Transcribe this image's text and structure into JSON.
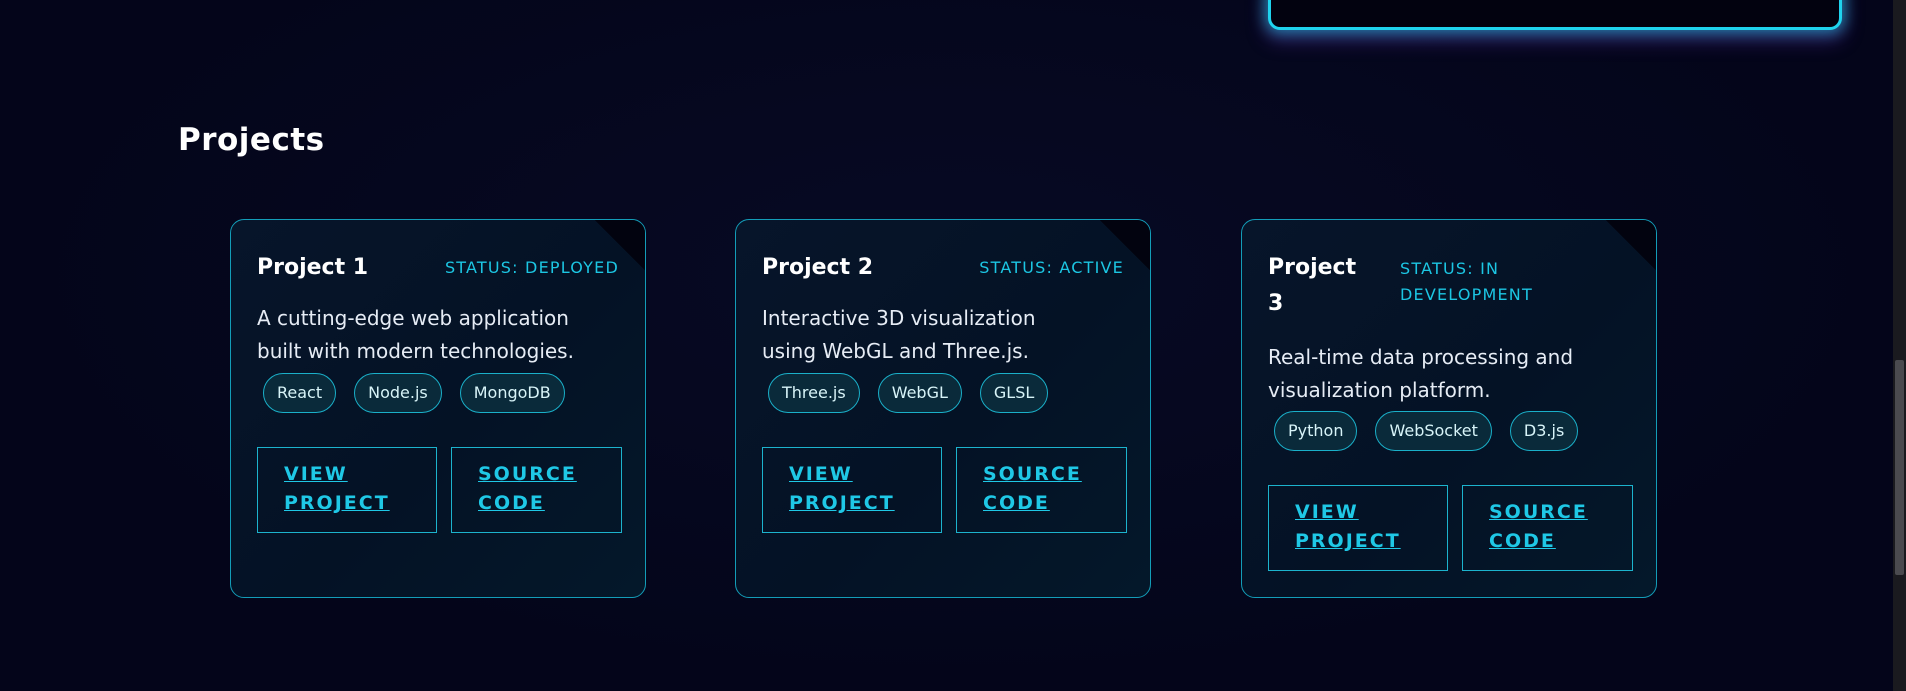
{
  "section": {
    "title": "Projects"
  },
  "projects": [
    {
      "title": "Project 1",
      "status": "STATUS: DEPLOYED",
      "description_line1": "A cutting-edge web application",
      "description_line2": "built with modern technologies.",
      "tags": [
        "React",
        "Node.js",
        "MongoDB"
      ],
      "view_label_line1": "VIEW",
      "view_label_line2": "PROJECT",
      "source_label_line1": "SOURCE",
      "source_label_line2": "CODE"
    },
    {
      "title": "Project 2",
      "status": "STATUS: ACTIVE",
      "description_line1": "Interactive 3D visualization",
      "description_line2": "using WebGL and Three.js.",
      "tags": [
        "Three.js",
        "WebGL",
        "GLSL"
      ],
      "view_label_line1": "VIEW",
      "view_label_line2": "PROJECT",
      "source_label_line1": "SOURCE",
      "source_label_line2": "CODE"
    },
    {
      "title_line1": "Project",
      "title_line2": "3",
      "status_line1": "STATUS: IN",
      "status_line2": "DEVELOPMENT",
      "description_line1": "Real-time data processing and",
      "description_line2": "visualization platform.",
      "tags": [
        "Python",
        "WebSocket",
        "D3.js"
      ],
      "view_label_line1": "VIEW",
      "view_label_line2": "PROJECT",
      "source_label_line1": "SOURCE",
      "source_label_line2": "CODE"
    }
  ],
  "colors": {
    "accent": "#1fc8e6",
    "background": "#04051a",
    "card_border": "#139db8"
  }
}
